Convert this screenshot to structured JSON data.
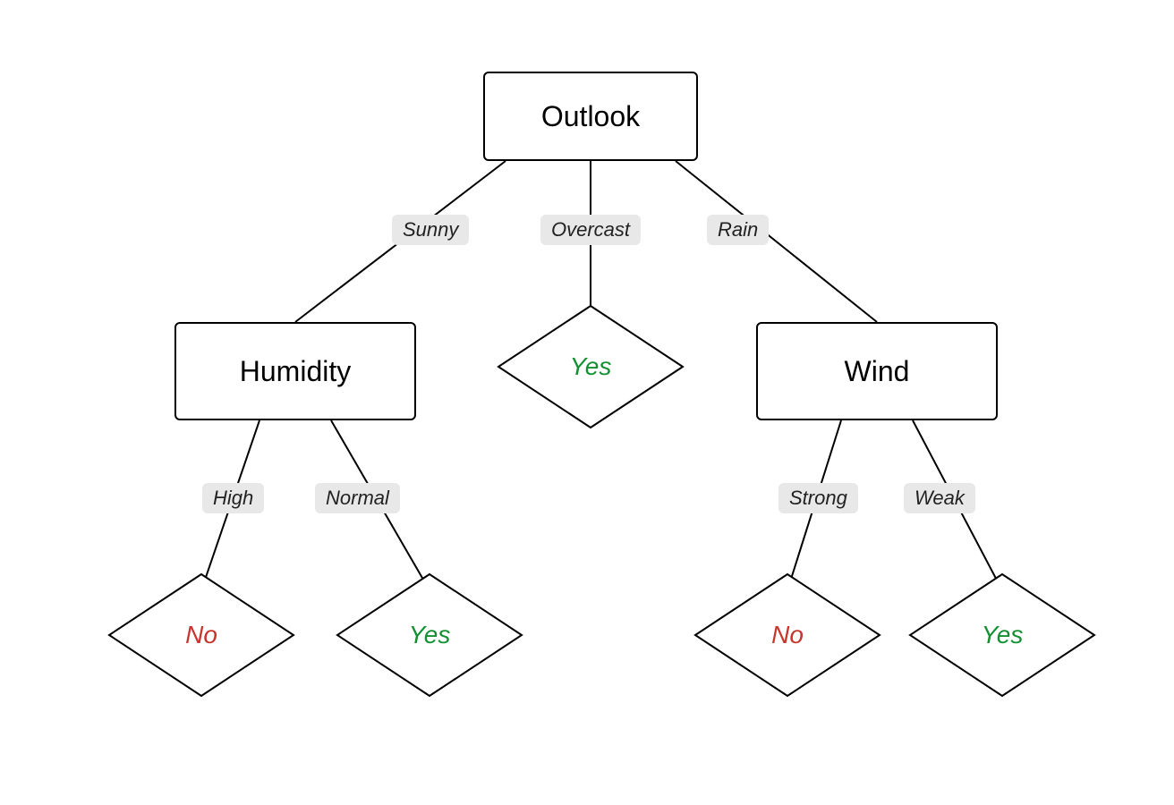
{
  "nodes": {
    "root": {
      "label": "Outlook"
    },
    "humidity": {
      "label": "Humidity"
    },
    "wind": {
      "label": "Wind"
    }
  },
  "edges": {
    "sunny": {
      "label": "Sunny"
    },
    "overcast": {
      "label": "Overcast"
    },
    "rain": {
      "label": "Rain"
    },
    "high": {
      "label": "High"
    },
    "normal": {
      "label": "Normal"
    },
    "strong": {
      "label": "Strong"
    },
    "weak": {
      "label": "Weak"
    }
  },
  "leaves": {
    "overcast_yes": {
      "label": "Yes",
      "class": "yes"
    },
    "humidity_high": {
      "label": "No",
      "class": "no"
    },
    "humidity_normal": {
      "label": "Yes",
      "class": "yes"
    },
    "wind_strong": {
      "label": "No",
      "class": "no"
    },
    "wind_weak": {
      "label": "Yes",
      "class": "yes"
    }
  },
  "colors": {
    "yes": "#149033",
    "no": "#c7352c",
    "edge_label_bg": "#e8e8e8"
  }
}
